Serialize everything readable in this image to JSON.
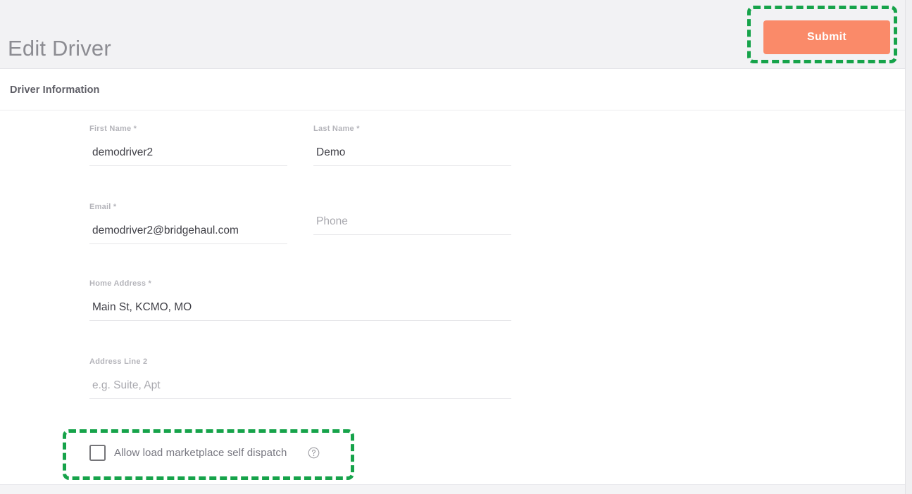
{
  "header": {
    "title": "Edit Driver",
    "submit_label": "Submit"
  },
  "section": {
    "title": "Driver Information"
  },
  "form": {
    "fields": [
      {
        "name": "first-name",
        "label": "First Name *",
        "value": "demodriver2",
        "placeholder": ""
      },
      {
        "name": "last-name",
        "label": "Last Name *",
        "value": "Demo",
        "placeholder": ""
      },
      {
        "name": "email",
        "label": "Email *",
        "value": "demodriver2@bridgehaul.com",
        "placeholder": ""
      },
      {
        "name": "phone",
        "label": "",
        "value": "",
        "placeholder": "Phone"
      },
      {
        "name": "home-address",
        "label": "Home Address *",
        "value": "Main St, KCMO, MO",
        "placeholder": ""
      },
      {
        "name": "address-line-2",
        "label": "Address Line 2",
        "value": "",
        "placeholder": "e.g. Suite, Apt"
      }
    ],
    "checkbox": {
      "label": "Allow load marketplace self dispatch",
      "checked": false,
      "help_icon": "question-circle-icon"
    }
  },
  "annotations": {
    "highlight_color": "#16a34a",
    "targets": [
      "submit-button",
      "self-dispatch-checkbox"
    ]
  },
  "colors": {
    "accent": "#fa8a69",
    "header_bg": "#f2f2f4",
    "title_text": "#8c8c92",
    "label_text": "#b4b4ba",
    "value_text": "#3f3f46"
  }
}
